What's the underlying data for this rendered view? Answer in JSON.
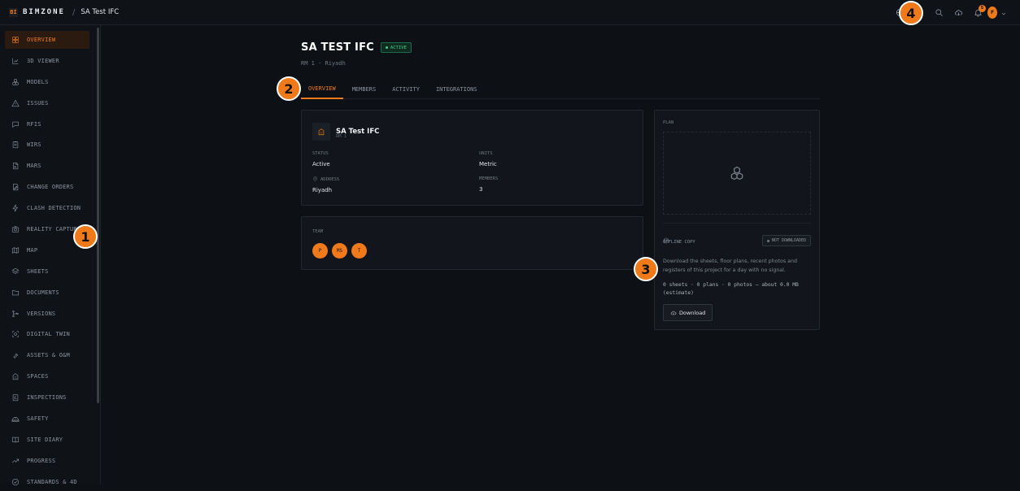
{
  "topbar": {
    "brand_mark": "BI",
    "brand_name": "BIMZONE",
    "breadcrumb": "SA Test IFC",
    "notification_count": "5",
    "user_initial": "F"
  },
  "sidebar": {
    "items": [
      {
        "label": "OVERVIEW",
        "icon": "grid-icon",
        "active": true
      },
      {
        "label": "3D VIEWER",
        "icon": "chart-axes-icon"
      },
      {
        "label": "MODELS",
        "icon": "cubes-icon"
      },
      {
        "label": "ISSUES",
        "icon": "warning-icon"
      },
      {
        "label": "RFIS",
        "icon": "chat-icon"
      },
      {
        "label": "WIRS",
        "icon": "clipboard-icon"
      },
      {
        "label": "MARS",
        "icon": "doc-return-icon"
      },
      {
        "label": "CHANGE ORDERS",
        "icon": "edit-doc-icon"
      },
      {
        "label": "CLASH DETECTION",
        "icon": "lightning-icon"
      },
      {
        "label": "REALITY CAPTURE",
        "icon": "camera-icon"
      },
      {
        "label": "MAP",
        "icon": "map-icon"
      },
      {
        "label": "SHEETS",
        "icon": "stack-icon"
      },
      {
        "label": "DOCUMENTS",
        "icon": "folder-icon"
      },
      {
        "label": "VERSIONS",
        "icon": "branch-icon"
      },
      {
        "label": "DIGITAL TWIN",
        "icon": "scan-icon"
      },
      {
        "label": "ASSETS & O&M",
        "icon": "wrench-icon"
      },
      {
        "label": "SPACES",
        "icon": "building-icon"
      },
      {
        "label": "INSPECTIONS",
        "icon": "checklist-icon"
      },
      {
        "label": "SAFETY",
        "icon": "helmet-icon"
      },
      {
        "label": "SITE DIARY",
        "icon": "book-icon"
      },
      {
        "label": "PROGRESS",
        "icon": "trend-icon"
      },
      {
        "label": "STANDARDS & 4D",
        "icon": "check-circle-icon"
      }
    ]
  },
  "project": {
    "title": "SA TEST IFC",
    "status_pill": "ACTIVE",
    "subtitle": "RM 1 · Riyadh"
  },
  "tabs": [
    "OVERVIEW",
    "MEMBERS",
    "ACTIVITY",
    "INTEGRATIONS"
  ],
  "info": {
    "name": "SA Test IFC",
    "code": "RM 1",
    "status_label": "STATUS",
    "status_value": "Active",
    "units_label": "UNITS",
    "units_value": "Metric",
    "address_label": "ADDRESS",
    "address_value": "Riyadh",
    "members_label": "MEMBERS",
    "members_value": "3"
  },
  "team": {
    "label": "TEAM",
    "members": [
      "P",
      "MS",
      "T"
    ]
  },
  "plan": {
    "label": "PLAN",
    "offline_label": "OFFLINE COPY",
    "offline_status": "NOT DOWNLOADED",
    "description": "Download the sheets, floor plans, recent photos and registers of this project for a day with no signal.",
    "estimate": "0 sheets · 0 plans · 0 photos — about 0.0 MB (estimate)",
    "download_label": "Download"
  },
  "markers": [
    "1",
    "2",
    "3",
    "4"
  ],
  "colors": {
    "accent": "#f07a1a",
    "success": "#3fd28b",
    "background": "#0d1015"
  }
}
